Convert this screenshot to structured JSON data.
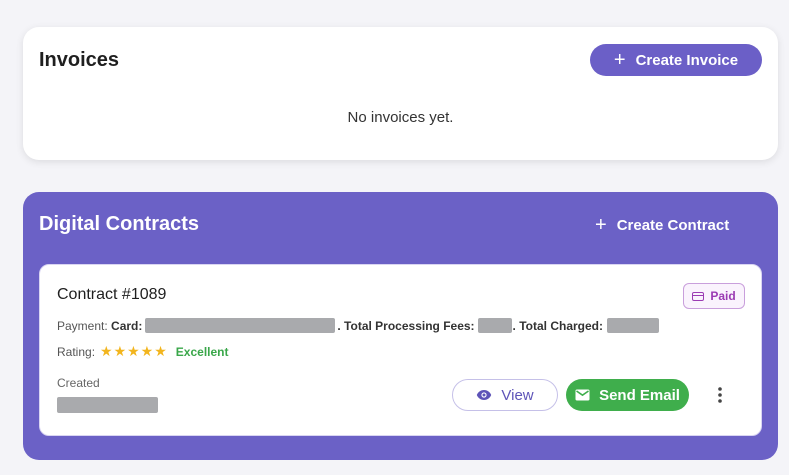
{
  "invoices": {
    "title": "Invoices",
    "create_button": "Create Invoice",
    "empty_message": "No invoices yet."
  },
  "contracts": {
    "title": "Digital Contracts",
    "create_button": "Create Contract",
    "items": [
      {
        "title": "Contract #1089",
        "status_badge": "Paid",
        "payment_label": "Payment:",
        "card_label": "Card:",
        "fees_label": ". Total Processing Fees:",
        "charged_label": ". Total Charged:",
        "rating_label": "Rating:",
        "rating_stars": "★★★★★",
        "rating_word": "Excellent",
        "created_label": "Created",
        "view_button": "View",
        "send_email_button": "Send Email"
      }
    ]
  },
  "icons": {
    "plus": "plus-icon",
    "card": "credit-card-icon",
    "eye": "eye-icon",
    "mail": "mail-icon",
    "more": "more-vertical-icon"
  },
  "colors": {
    "accent": "#6b5fc7",
    "panel": "#6b61c6",
    "success": "#3fae4c",
    "star": "#f2b51e",
    "badge_text": "#9b3bb3",
    "redaction": "#a9aaad"
  }
}
